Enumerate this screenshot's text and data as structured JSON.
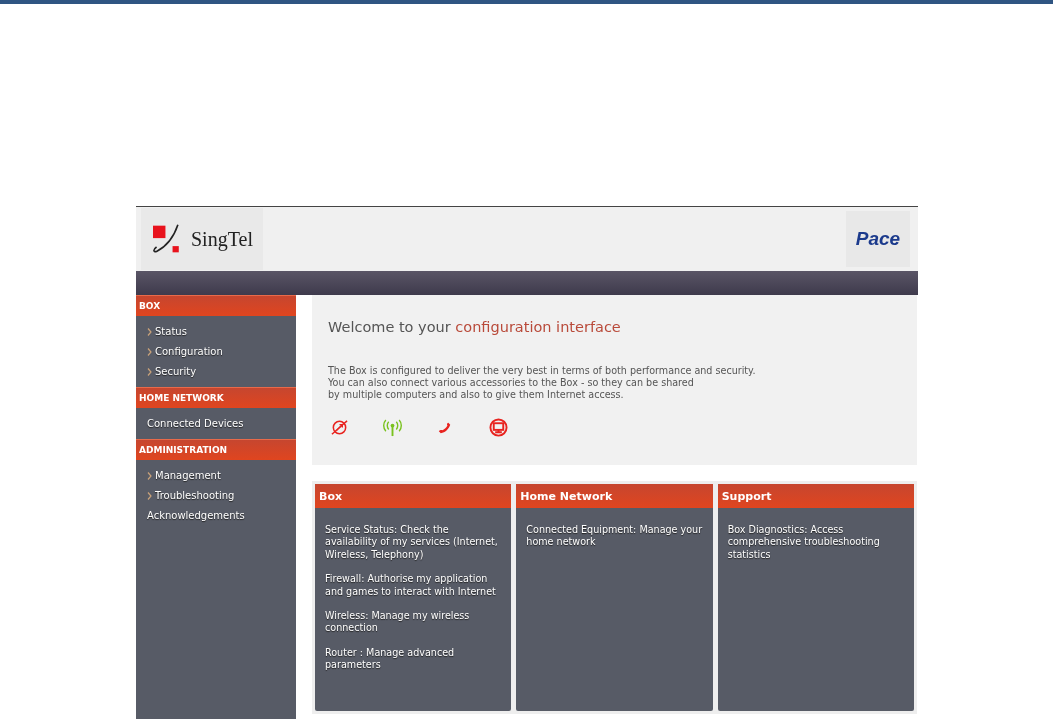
{
  "header": {
    "brand": "SingTel",
    "partner": "Pace"
  },
  "sidebar": {
    "sections": [
      {
        "title": "BOX",
        "items": [
          {
            "label": "Status",
            "kind": "arrow"
          },
          {
            "label": "Configuration",
            "kind": "arrow"
          },
          {
            "label": "Security",
            "kind": "arrow"
          }
        ]
      },
      {
        "title": "HOME NETWORK",
        "items": [
          {
            "label": "Connected Devices",
            "kind": "plain"
          }
        ]
      },
      {
        "title": "ADMINISTRATION",
        "items": [
          {
            "label": "Management",
            "kind": "arrow"
          },
          {
            "label": "Troubleshooting",
            "kind": "arrow"
          },
          {
            "label": "Acknowledgements",
            "kind": "plain"
          }
        ]
      }
    ]
  },
  "welcome": {
    "title_lead": "Welcome to your",
    "title_highlight": "configuration interface",
    "description_lines": [
      "The Box is configured to deliver the very best in terms of both performance and security.",
      "You can also connect various accessories to the Box - so they can be shared",
      "by multiple computers and also to give them Internet access."
    ],
    "services": [
      {
        "kind": "internet",
        "color": "#e8231f"
      },
      {
        "kind": "wireless",
        "color": "#7ac21f"
      },
      {
        "kind": "telephony",
        "color": "#e8231f"
      },
      {
        "kind": "tv",
        "color": "#e8231f"
      }
    ]
  },
  "cards": [
    {
      "title": "Box",
      "entries": [
        "Service Status: Check the availability of my services (Internet, Wireless, Telephony)",
        "Firewall: Authorise my application and games to interact with Internet",
        "Wireless: Manage my wireless connection",
        "Router : Manage advanced parameters"
      ]
    },
    {
      "title": "Home Network",
      "entries": [
        "Connected Equipment: Manage your home network"
      ]
    },
    {
      "title": "Support",
      "entries": [
        "Box Diagnostics: Access comprehensive troubleshooting statistics"
      ]
    }
  ]
}
